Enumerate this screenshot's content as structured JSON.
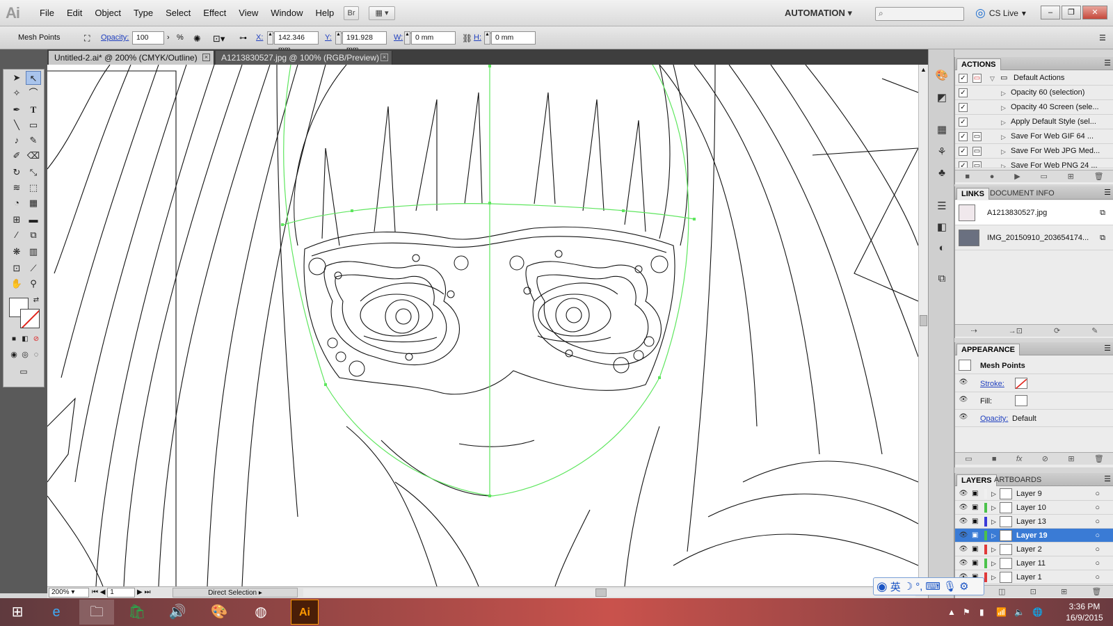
{
  "app": {
    "logo": "Ai"
  },
  "menu": [
    "File",
    "Edit",
    "Object",
    "Type",
    "Select",
    "Effect",
    "View",
    "Window",
    "Help"
  ],
  "menubar": {
    "bridge_label": "Br",
    "workspace": "AUTOMATION",
    "cs_live": "CS Live",
    "win_min": "–",
    "win_max": "❐",
    "win_close": "✕"
  },
  "control": {
    "selection": "Mesh Points",
    "opacity_label": "Opacity:",
    "opacity_value": "100",
    "percent": "%",
    "x_label": "X:",
    "x_value": "142.346 mm",
    "y_label": "Y:",
    "y_value": "191.928 mm",
    "w_label": "W:",
    "w_value": "0 mm",
    "h_label": "H:",
    "h_value": "0 mm"
  },
  "tabs": [
    {
      "label": "Untitled-2.ai* @ 200% (CMYK/Outline)",
      "active": true
    },
    {
      "label": "A1213830527.jpg @ 100% (RGB/Preview)",
      "active": false
    }
  ],
  "status": {
    "zoom": "200%",
    "artboard": "1",
    "tool": "Direct Selection"
  },
  "actions": {
    "tab": "ACTIONS",
    "items": [
      "Default Actions",
      "Opacity 60 (selection)",
      "Opacity 40 Screen (sele...",
      "Apply Default Style (sel...",
      "Save For Web GIF 64 ...",
      "Save For Web JPG Med...",
      "Save For Web PNG 24 ..."
    ]
  },
  "links": {
    "tabs": [
      "LINKS",
      "DOCUMENT INFO"
    ],
    "items": [
      "A1213830527.jpg",
      "IMG_20150910_203654174..."
    ]
  },
  "appearance": {
    "tab": "APPEARANCE",
    "title": "Mesh Points",
    "stroke_label": "Stroke:",
    "fill_label": "Fill:",
    "opacity_label": "Opacity:",
    "opacity_value": "Default"
  },
  "layers": {
    "tabs": [
      "LAYERS",
      "ARTBOARDS"
    ],
    "items": [
      {
        "name": "Layer 9",
        "color": "#f0f0f0"
      },
      {
        "name": "Layer 10",
        "color": "#4bc24b"
      },
      {
        "name": "Layer 13",
        "color": "#3a3ad8"
      },
      {
        "name": "Layer 19",
        "color": "#4bc24b",
        "selected": true
      },
      {
        "name": "Layer 2",
        "color": "#e03a3a"
      },
      {
        "name": "Layer 11",
        "color": "#4bc24b"
      },
      {
        "name": "Layer 1",
        "color": "#e03a3a"
      }
    ]
  },
  "ime": {
    "lang": "英"
  },
  "clock": {
    "time": "3:36 PM",
    "date": "16/9/2015"
  },
  "colors": {
    "accent": "#3a7bd5",
    "taskbar": "#c9524c",
    "guide": "#5ee65e"
  }
}
